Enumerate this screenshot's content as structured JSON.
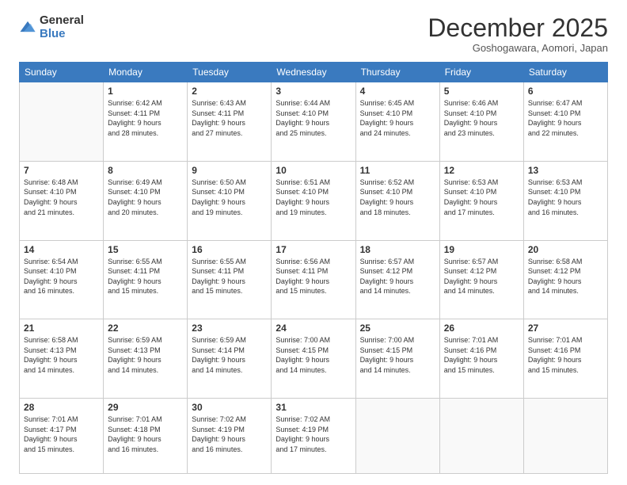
{
  "logo": {
    "general": "General",
    "blue": "Blue"
  },
  "header": {
    "month": "December 2025",
    "location": "Goshogawara, Aomori, Japan"
  },
  "days_of_week": [
    "Sunday",
    "Monday",
    "Tuesday",
    "Wednesday",
    "Thursday",
    "Friday",
    "Saturday"
  ],
  "weeks": [
    [
      {
        "num": "",
        "info": ""
      },
      {
        "num": "1",
        "info": "Sunrise: 6:42 AM\nSunset: 4:11 PM\nDaylight: 9 hours\nand 28 minutes."
      },
      {
        "num": "2",
        "info": "Sunrise: 6:43 AM\nSunset: 4:11 PM\nDaylight: 9 hours\nand 27 minutes."
      },
      {
        "num": "3",
        "info": "Sunrise: 6:44 AM\nSunset: 4:10 PM\nDaylight: 9 hours\nand 25 minutes."
      },
      {
        "num": "4",
        "info": "Sunrise: 6:45 AM\nSunset: 4:10 PM\nDaylight: 9 hours\nand 24 minutes."
      },
      {
        "num": "5",
        "info": "Sunrise: 6:46 AM\nSunset: 4:10 PM\nDaylight: 9 hours\nand 23 minutes."
      },
      {
        "num": "6",
        "info": "Sunrise: 6:47 AM\nSunset: 4:10 PM\nDaylight: 9 hours\nand 22 minutes."
      }
    ],
    [
      {
        "num": "7",
        "info": "Sunrise: 6:48 AM\nSunset: 4:10 PM\nDaylight: 9 hours\nand 21 minutes."
      },
      {
        "num": "8",
        "info": "Sunrise: 6:49 AM\nSunset: 4:10 PM\nDaylight: 9 hours\nand 20 minutes."
      },
      {
        "num": "9",
        "info": "Sunrise: 6:50 AM\nSunset: 4:10 PM\nDaylight: 9 hours\nand 19 minutes."
      },
      {
        "num": "10",
        "info": "Sunrise: 6:51 AM\nSunset: 4:10 PM\nDaylight: 9 hours\nand 19 minutes."
      },
      {
        "num": "11",
        "info": "Sunrise: 6:52 AM\nSunset: 4:10 PM\nDaylight: 9 hours\nand 18 minutes."
      },
      {
        "num": "12",
        "info": "Sunrise: 6:53 AM\nSunset: 4:10 PM\nDaylight: 9 hours\nand 17 minutes."
      },
      {
        "num": "13",
        "info": "Sunrise: 6:53 AM\nSunset: 4:10 PM\nDaylight: 9 hours\nand 16 minutes."
      }
    ],
    [
      {
        "num": "14",
        "info": "Sunrise: 6:54 AM\nSunset: 4:10 PM\nDaylight: 9 hours\nand 16 minutes."
      },
      {
        "num": "15",
        "info": "Sunrise: 6:55 AM\nSunset: 4:11 PM\nDaylight: 9 hours\nand 15 minutes."
      },
      {
        "num": "16",
        "info": "Sunrise: 6:55 AM\nSunset: 4:11 PM\nDaylight: 9 hours\nand 15 minutes."
      },
      {
        "num": "17",
        "info": "Sunrise: 6:56 AM\nSunset: 4:11 PM\nDaylight: 9 hours\nand 15 minutes."
      },
      {
        "num": "18",
        "info": "Sunrise: 6:57 AM\nSunset: 4:12 PM\nDaylight: 9 hours\nand 14 minutes."
      },
      {
        "num": "19",
        "info": "Sunrise: 6:57 AM\nSunset: 4:12 PM\nDaylight: 9 hours\nand 14 minutes."
      },
      {
        "num": "20",
        "info": "Sunrise: 6:58 AM\nSunset: 4:12 PM\nDaylight: 9 hours\nand 14 minutes."
      }
    ],
    [
      {
        "num": "21",
        "info": "Sunrise: 6:58 AM\nSunset: 4:13 PM\nDaylight: 9 hours\nand 14 minutes."
      },
      {
        "num": "22",
        "info": "Sunrise: 6:59 AM\nSunset: 4:13 PM\nDaylight: 9 hours\nand 14 minutes."
      },
      {
        "num": "23",
        "info": "Sunrise: 6:59 AM\nSunset: 4:14 PM\nDaylight: 9 hours\nand 14 minutes."
      },
      {
        "num": "24",
        "info": "Sunrise: 7:00 AM\nSunset: 4:15 PM\nDaylight: 9 hours\nand 14 minutes."
      },
      {
        "num": "25",
        "info": "Sunrise: 7:00 AM\nSunset: 4:15 PM\nDaylight: 9 hours\nand 14 minutes."
      },
      {
        "num": "26",
        "info": "Sunrise: 7:01 AM\nSunset: 4:16 PM\nDaylight: 9 hours\nand 15 minutes."
      },
      {
        "num": "27",
        "info": "Sunrise: 7:01 AM\nSunset: 4:16 PM\nDaylight: 9 hours\nand 15 minutes."
      }
    ],
    [
      {
        "num": "28",
        "info": "Sunrise: 7:01 AM\nSunset: 4:17 PM\nDaylight: 9 hours\nand 15 minutes."
      },
      {
        "num": "29",
        "info": "Sunrise: 7:01 AM\nSunset: 4:18 PM\nDaylight: 9 hours\nand 16 minutes."
      },
      {
        "num": "30",
        "info": "Sunrise: 7:02 AM\nSunset: 4:19 PM\nDaylight: 9 hours\nand 16 minutes."
      },
      {
        "num": "31",
        "info": "Sunrise: 7:02 AM\nSunset: 4:19 PM\nDaylight: 9 hours\nand 17 minutes."
      },
      {
        "num": "",
        "info": ""
      },
      {
        "num": "",
        "info": ""
      },
      {
        "num": "",
        "info": ""
      }
    ]
  ]
}
